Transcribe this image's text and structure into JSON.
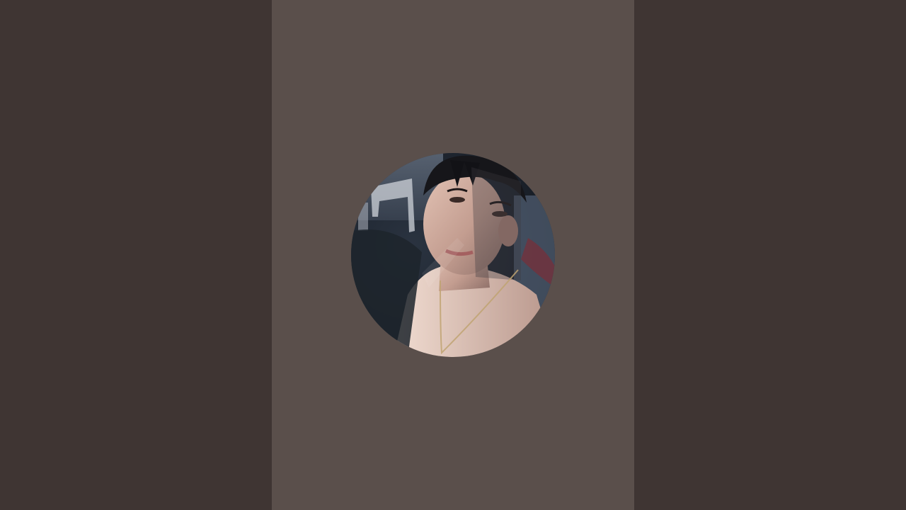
{
  "colors": {
    "side_background": "#3f3533",
    "center_background": "#5a4f4b",
    "photo_shadow": "#1f252c",
    "photo_skin": "#c9a79a",
    "photo_hair": "#16161a"
  },
  "avatar": {
    "icon": "profile-photo",
    "shape": "circle"
  }
}
